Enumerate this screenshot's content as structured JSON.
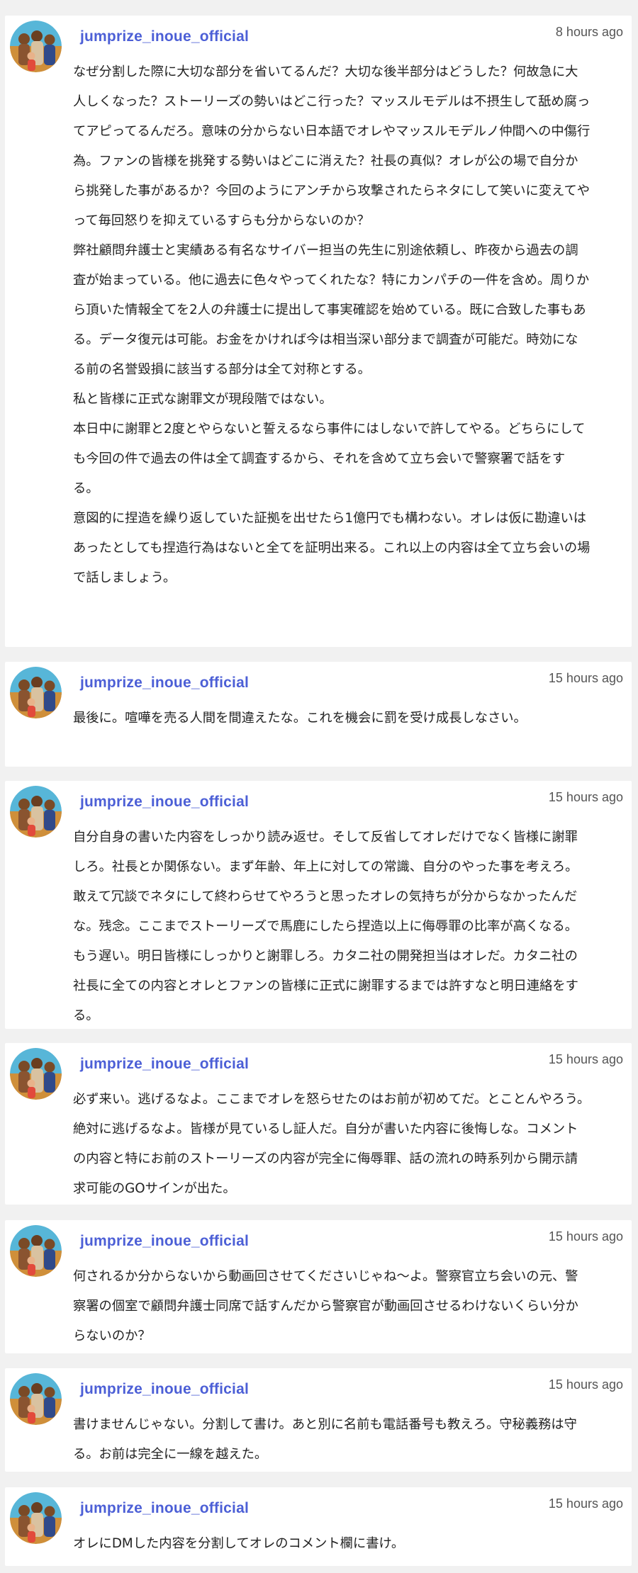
{
  "comments": [
    {
      "username": "jumprize_inoue_official",
      "time": "8 hours ago",
      "paragraphs": [
        "なぜ分割した際に大切な部分を省いてるんだ？大切な後半部分はどうした？何故急に大人しくなった？ストーリーズの勢いはどこ行った？マッスルモデルは不摂生して舐め腐ってアピってるんだろ。意味の分からない日本語でオレやマッスルモデルノ仲間への中傷行為。ファンの皆様を挑発する勢いはどこに消えた？社長の真似？オレが公の場で自分から挑発した事があるか？今回のようにアンチから攻撃されたらネタにして笑いに変えてやって毎回怒りを抑えているすらも分からないのか？",
        "弊社顧問弁護士と実績ある有名なサイバー担当の先生に別途依頼し、昨夜から過去の調査が始まっている。他に過去に色々やってくれたな？特にカンパチの一件を含め。周りから頂いた情報全てを2人の弁護士に提出して事実確認を始めている。既に合致した事もある。データ復元は可能。お金をかければ今は相当深い部分まで調査が可能だ。時効になる前の名誉毀損に該当する部分は全て対称とする。",
        "私と皆様に正式な謝罪文が現段階ではない。",
        "本日中に謝罪と2度とやらないと誓えるなら事件にはしないで許してやる。どちらにしても今回の件で過去の件は全て調査するから、それを含めて立ち会いで警察署で話をする。",
        "意図的に捏造を繰り返していた証拠を出せたら1億円でも構わない。オレは仮に勘違いはあったとしても捏造行為はないと全てを証明出来る。これ以上の内容は全て立ち会いの場で話しましょう。"
      ]
    },
    {
      "username": "jumprize_inoue_official",
      "time": "15 hours ago",
      "paragraphs": [
        "最後に。喧嘩を売る人間を間違えたな。これを機会に罰を受け成長しなさい。"
      ]
    },
    {
      "username": "jumprize_inoue_official",
      "time": "15 hours ago",
      "paragraphs": [
        "自分自身の書いた内容をしっかり読み返せ。そして反省してオレだけでなく皆様に謝罪しろ。社長とか関係ない。まず年齢、年上に対しての常識、自分のやった事を考えろ。敢えて冗談でネタにして終わらせてやろうと思ったオレの気持ちが分からなかったんだな。残念。ここまでストーリーズで馬鹿にしたら捏造以上に侮辱罪の比率が高くなる。もう遅い。明日皆様にしっかりと謝罪しろ。カタニ社の開発担当はオレだ。カタニ社の社長に全ての内容とオレとファンの皆様に正式に謝罪するまでは許すなと明日連絡をする。"
      ]
    },
    {
      "username": "jumprize_inoue_official",
      "time": "15 hours ago",
      "paragraphs": [
        "必ず来い。逃げるなよ。ここまでオレを怒らせたのはお前が初めてだ。とことんやろう。絶対に逃げるなよ。皆様が見ているし証人だ。自分が書いた内容に後悔しな。コメントの内容と特にお前のストーリーズの内容が完全に侮辱罪、話の流れの時系列から開示請求可能のGOサインが出た。"
      ]
    },
    {
      "username": "jumprize_inoue_official",
      "time": "15 hours ago",
      "paragraphs": [
        "何されるか分からないから動画回させてくださいじゃね〜よ。警察官立ち会いの元、警察署の個室で顧問弁護士同席で話すんだから警察官が動画回させるわけないくらい分からないのか？"
      ]
    },
    {
      "username": "jumprize_inoue_official",
      "time": "15 hours ago",
      "paragraphs": [
        "書けませんじゃない。分割して書け。あと別に名前も電話番号も教えろ。守秘義務は守る。お前は完全に一線を越えた。"
      ]
    },
    {
      "username": "jumprize_inoue_official",
      "time": "15 hours ago",
      "paragraphs": [
        "オレにDMした内容を分割してオレのコメント欄に書け。"
      ]
    }
  ]
}
